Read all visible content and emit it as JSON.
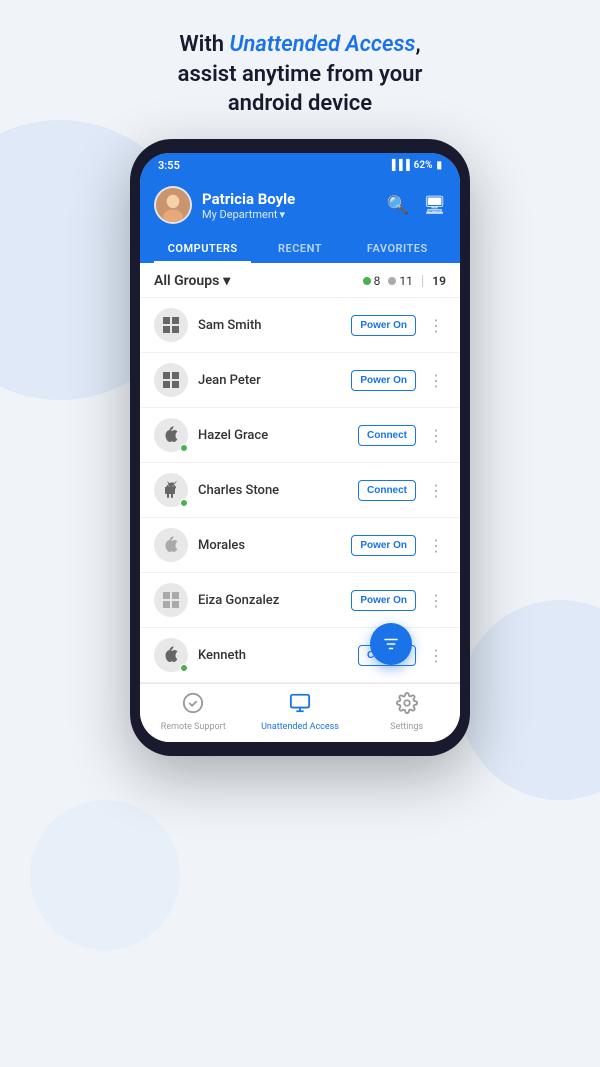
{
  "page": {
    "header_text_1": "With ",
    "header_highlight": "Unattended Access",
    "header_text_2": ",",
    "header_line2": "assist anytime from your",
    "header_line3": "android device"
  },
  "status_bar": {
    "time": "3:55",
    "battery": "62%"
  },
  "app_header": {
    "user_name": "Patricia Boyle",
    "department": "My Department",
    "search_icon": "search",
    "monitor_icon": "monitor"
  },
  "tabs": [
    {
      "label": "COMPUTERS",
      "active": true
    },
    {
      "label": "RECENT",
      "active": false
    },
    {
      "label": "FAVORITES",
      "active": false
    }
  ],
  "groups": {
    "label": "All Groups",
    "online_count": "8",
    "offline_count": "11",
    "total": "19"
  },
  "computers": [
    {
      "name": "Sam Smith",
      "icon_type": "windows",
      "status": "offline",
      "action": "Power On"
    },
    {
      "name": "Jean Peter",
      "icon_type": "windows",
      "status": "offline",
      "action": "Power On"
    },
    {
      "name": "Hazel Grace",
      "icon_type": "apple",
      "status": "online",
      "action": "Connect"
    },
    {
      "name": "Charles Stone",
      "icon_type": "android",
      "status": "online",
      "action": "Connect"
    },
    {
      "name": "Morales",
      "icon_type": "apple",
      "status": "offline",
      "action": "Power On"
    },
    {
      "name": "Eiza Gonzalez",
      "icon_type": "windows",
      "status": "offline",
      "action": "Power On"
    },
    {
      "name": "Kenneth",
      "icon_type": "apple",
      "status": "online",
      "action": "Connect"
    }
  ],
  "bottom_nav": [
    {
      "label": "Remote Support",
      "icon": "remote",
      "active": false
    },
    {
      "label": "Unattended Access",
      "icon": "monitor",
      "active": true
    },
    {
      "label": "Settings",
      "icon": "settings",
      "active": false
    }
  ]
}
